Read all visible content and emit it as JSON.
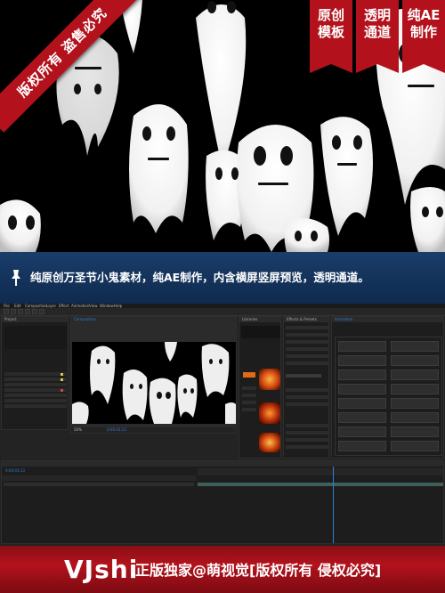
{
  "hero": {
    "ribbon": "版权所有 盗售必究",
    "tags": [
      {
        "line1": "原创",
        "line2": "模板"
      },
      {
        "line1": "透明",
        "line2": "通道"
      },
      {
        "line1": "纯AE",
        "line2": "制作"
      }
    ]
  },
  "caption": {
    "icon": "pushpin-icon",
    "text": "纯原创万圣节小鬼素材，纯AE制作，内含横屏竖屏预览，透明通道。"
  },
  "ae": {
    "menu": [
      "File",
      "Edit",
      "Composition",
      "Layer",
      "Effect",
      "Animation",
      "View",
      "Window",
      "Help"
    ],
    "project_title": "Project",
    "composition_tab": "Composition",
    "effects_title": "Effects & Presets",
    "library_title": "Libraries",
    "animation_panel": "Animation",
    "timecode": "0:00:03:13",
    "zoom": "50%",
    "colors": {
      "bg": "#232323",
      "panel": "#1d1d1d",
      "accent": "#2f7fd3",
      "orange": "#e06a1a"
    }
  },
  "banner": {
    "brand": "VJshi",
    "text": "正版独家@萌视觉[版权所有 侵权必究]"
  }
}
